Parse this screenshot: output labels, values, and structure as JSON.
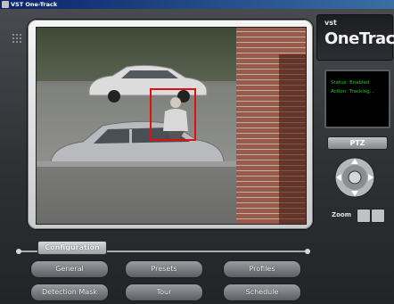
{
  "window": {
    "title": "VST One-Track"
  },
  "brand": {
    "prefix": "vst",
    "name": "OneTrack"
  },
  "status": {
    "line1": "Status: Enabled",
    "line2": "Action: Tracking..."
  },
  "ptz": {
    "label": "PTZ",
    "zoom_label": "Zoom"
  },
  "config": {
    "tab_label": "Configuration",
    "buttons": [
      "General",
      "Presets",
      "Profiles",
      "Detection Mask",
      "Tour",
      "Schedule"
    ]
  },
  "colors": {
    "status_text": "#19d419",
    "tracking_box": "#e01010"
  },
  "icons": [
    "grip-icon",
    "dpad-icon",
    "zoom-out-icon",
    "zoom-in-icon"
  ]
}
